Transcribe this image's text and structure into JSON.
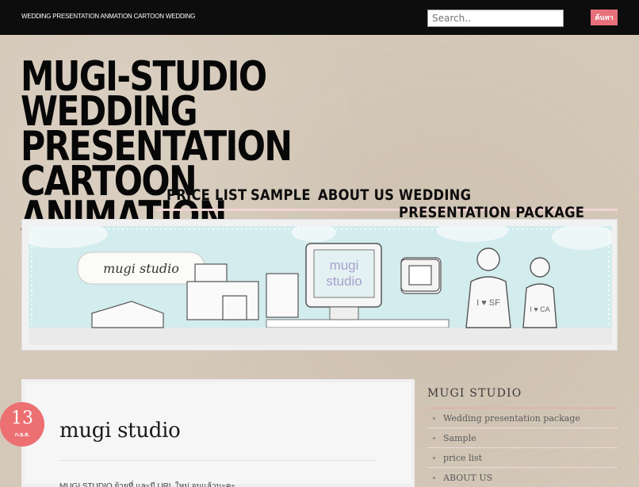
{
  "topbar": {
    "tagline": "WEDDING PRESENTATION ANMATION CARTOON WEDDING",
    "search_placeholder": "Search..",
    "search_button": "ค้นหา"
  },
  "site": {
    "title": "MUGI-STUDIO WEDDING PRESENTATION CARTOON ANIMATION"
  },
  "nav": {
    "items": [
      {
        "label": "PRICE LIST"
      },
      {
        "label": "SAMPLE"
      },
      {
        "label": "ABOUT US"
      },
      {
        "label": "WEDDING PRESENTATION PACKAGE"
      }
    ]
  },
  "banner": {
    "logo_text": "mugi studio",
    "screen_text_1": "mugi",
    "screen_text_2": "studio",
    "shirt_text": "I ♥ SF",
    "shirt_text_2": "I ♥ CA"
  },
  "post": {
    "date_day": "13",
    "date_month": "ก.ย.ส.",
    "title": "mugi studio",
    "excerpt": "MUGI STUDIO ย้ายที่ และมี URL ใหม่ จนแล้วนะคะ"
  },
  "sidebar": {
    "widget_title": "MUGI STUDIO",
    "items": [
      {
        "label": "Wedding presentation package"
      },
      {
        "label": "Sample"
      },
      {
        "label": "price list"
      },
      {
        "label": "ABOUT US"
      }
    ]
  },
  "colors": {
    "accent": "#ec6f72",
    "topbar_bg": "#0d0d0d",
    "page_bg": "#d4c8b8",
    "banner_bg": "#d3ecee"
  }
}
